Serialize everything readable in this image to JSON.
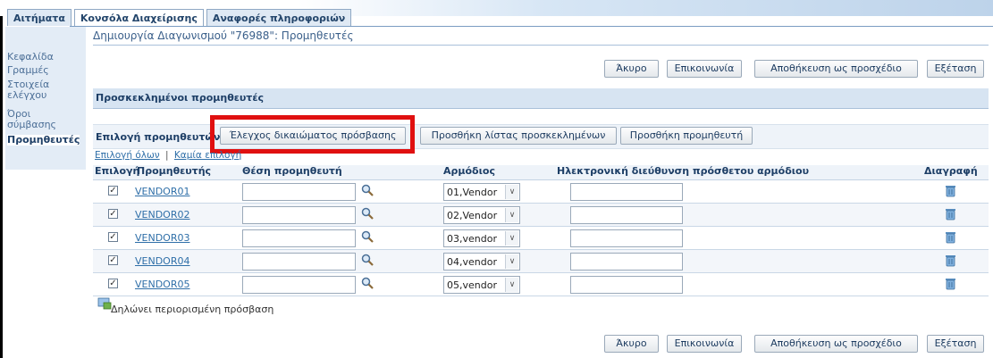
{
  "tabs": [
    {
      "label": "Αιτήματα"
    },
    {
      "label": "Κονσόλα Διαχείρισης"
    },
    {
      "label": "Αναφορές πληροφοριών"
    }
  ],
  "sidebar": {
    "items": [
      {
        "label": "Κεφαλίδα"
      },
      {
        "label": "Γραμμές"
      },
      {
        "label": "Στοιχεία"
      },
      {
        "label": "ελέγχου"
      },
      {
        "label": "Όροι"
      },
      {
        "label": "σύμβασης"
      },
      {
        "label": "Προμηθευτές"
      }
    ]
  },
  "page": {
    "title": "Δημιουργία Διαγωνισμού \"76988\": Προμηθευτές"
  },
  "actions": {
    "cancel": "Άκυρο",
    "contact": "Επικοινωνία",
    "save_draft": "Αποθήκευση ως προσχέδιο",
    "review": "Εξέταση"
  },
  "section": {
    "title": "Προσκεκλημένοι προμηθευτές"
  },
  "toolbar": {
    "label": "Επιλογή προμηθευτών:",
    "check_access": "Έλεγχος δικαιώματος πρόσβασης",
    "add_invited_list": "Προσθήκη λίστας προσκεκλημένων",
    "add_supplier": "Προσθήκη προμηθευτή"
  },
  "selection": {
    "select_all": "Επιλογή όλων",
    "select_none": "Καμία επιλογή"
  },
  "table": {
    "headers": {
      "select": "Επιλογή",
      "supplier": "Προμηθευτής",
      "site": "Θέση προμηθευτή",
      "contact": "Αρμόδιος",
      "email": "Ηλεκτρονική διεύθυνση πρόσθετου αρμόδιου",
      "delete": "Διαγραφή"
    },
    "rows": [
      {
        "supplier": "VENDOR01",
        "contact": "01,Vendor",
        "checked": true
      },
      {
        "supplier": "VENDOR02",
        "contact": "02,Vendor",
        "checked": true
      },
      {
        "supplier": "VENDOR03",
        "contact": "03,vendor",
        "checked": true
      },
      {
        "supplier": "VENDOR04",
        "contact": "04,vendor",
        "checked": true
      },
      {
        "supplier": "VENDOR05",
        "contact": "05,vendor",
        "checked": true
      }
    ]
  },
  "note": "Δηλώνει περιορισμένη πρόσβαση",
  "colors": {
    "accent": "#2f6fa8",
    "highlight": "#e01010",
    "header_bg": "#d7e4f2"
  }
}
